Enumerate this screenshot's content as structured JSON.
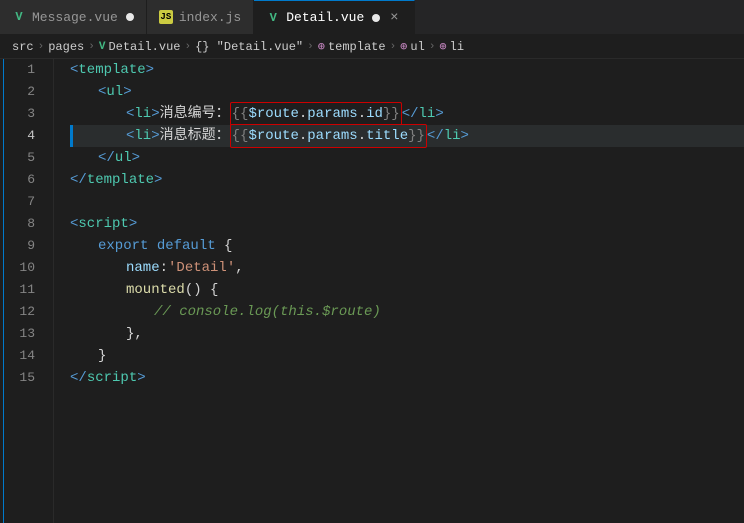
{
  "tabs": [
    {
      "id": "message-vue",
      "label": "Message.vue",
      "modified": true,
      "active": false,
      "icon_type": "vue",
      "icon_color": "#42b883"
    },
    {
      "id": "index-js",
      "label": "index.js",
      "modified": false,
      "active": false,
      "icon_type": "js",
      "icon_color": "#cbcb41"
    },
    {
      "id": "detail-vue",
      "label": "Detail.vue",
      "modified": true,
      "active": true,
      "icon_type": "vue",
      "icon_color": "#42b883"
    }
  ],
  "breadcrumb": {
    "items": [
      "src",
      "pages",
      "Detail.vue",
      "{} \"Detail.vue\"",
      "template",
      "ul",
      "li"
    ]
  },
  "lines": [
    {
      "num": 1,
      "content": "template_open"
    },
    {
      "num": 2,
      "content": "ul_open"
    },
    {
      "num": 3,
      "content": "li_id"
    },
    {
      "num": 4,
      "content": "li_title"
    },
    {
      "num": 5,
      "content": "ul_close"
    },
    {
      "num": 6,
      "content": "template_close"
    },
    {
      "num": 7,
      "content": "empty"
    },
    {
      "num": 8,
      "content": "script_open"
    },
    {
      "num": 9,
      "content": "export_default"
    },
    {
      "num": 10,
      "content": "name_detail"
    },
    {
      "num": 11,
      "content": "mounted"
    },
    {
      "num": 12,
      "content": "console_log"
    },
    {
      "num": 13,
      "content": "close_brace"
    },
    {
      "num": 14,
      "content": "close_brace2"
    },
    {
      "num": 15,
      "content": "script_close"
    }
  ],
  "code": {
    "li_id_prefix": "<li>消息编号：",
    "li_id_expr": "{{$route.params.id}}",
    "li_id_suffix": "</li>",
    "li_title_prefix": "<li>消息标题：",
    "li_title_expr": "{{$route.params.title}}",
    "li_title_suffix": "</li>",
    "comment_text": "// console.log(this.$route)"
  }
}
